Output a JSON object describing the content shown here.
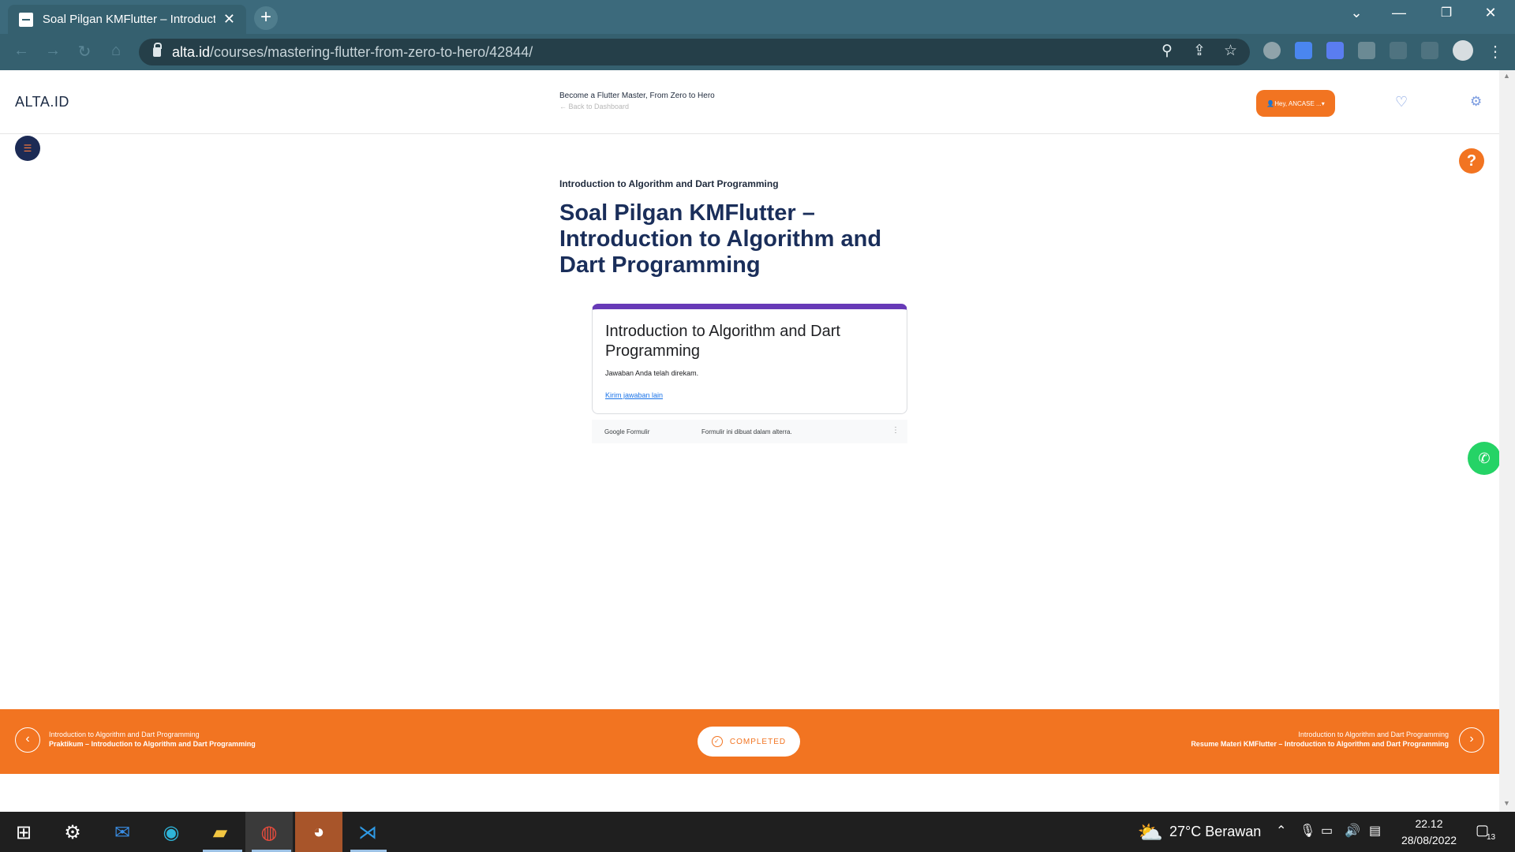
{
  "browser": {
    "tab_title": "Soal Pilgan KMFlutter – Introduct",
    "tab_close": "✕",
    "new_tab": "+",
    "url_domain": "alta.id",
    "url_path": "/courses/mastering-flutter-from-zero-to-hero/42844/"
  },
  "header": {
    "logo": "ALTA.ID",
    "course_title": "Become a Flutter Master, From Zero to Hero",
    "back_link": "Back to Dashboard",
    "user_button": "Hey, ANCASE ..."
  },
  "lesson": {
    "subtitle": "Introduction to Algorithm and Dart Programming",
    "title": "Soal Pilgan KMFlutter – Introduction to Algorithm and Dart Programming"
  },
  "form": {
    "title": "Introduction to Algorithm and Dart Programming",
    "message": "Jawaban Anda telah direkam.",
    "link": "Kirim jawaban lain",
    "footer_brand": "Google Formulir",
    "footer_note": "Formulir ini dibuat dalam alterra."
  },
  "bottom_nav": {
    "prev_section": "Introduction to Algorithm and Dart Programming",
    "prev_title": "Praktikum – Introduction to Algorithm and Dart Programming",
    "completed_label": "COMPLETED",
    "next_section": "Introduction to Algorithm and Dart Programming",
    "next_title": "Resume Materi KMFlutter – Introduction to Algorithm and Dart Programming"
  },
  "taskbar": {
    "weather": "27°C  Berawan",
    "time": "22.12",
    "date": "28/08/2022",
    "notification_count": "13"
  },
  "colors": {
    "accent": "#f27421",
    "navy": "#1a2e5a",
    "form_accent": "#673ab7",
    "chrome": "#3c6a7c"
  }
}
